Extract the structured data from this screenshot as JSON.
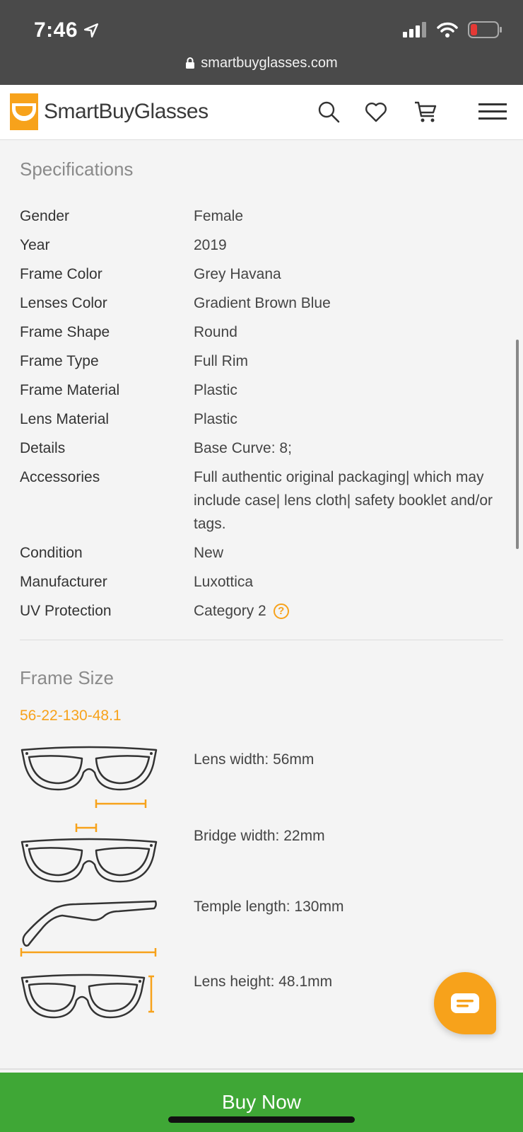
{
  "status_bar": {
    "time": "7:46",
    "url": "smartbuyglasses.com"
  },
  "header": {
    "logo_text": "SmartBuyGlasses",
    "brand_color": "#f7a21b"
  },
  "specifications": {
    "title": "Specifications",
    "rows": [
      {
        "label": "Gender",
        "value": "Female"
      },
      {
        "label": "Year",
        "value": "2019"
      },
      {
        "label": "Frame Color",
        "value": "Grey Havana"
      },
      {
        "label": "Lenses Color",
        "value": "Gradient Brown Blue"
      },
      {
        "label": "Frame Shape",
        "value": "Round"
      },
      {
        "label": "Frame Type",
        "value": "Full Rim"
      },
      {
        "label": "Frame Material",
        "value": "Plastic"
      },
      {
        "label": "Lens Material",
        "value": "Plastic"
      },
      {
        "label": "Details",
        "value": "Base Curve: 8;"
      },
      {
        "label": "Accessories",
        "value": "Full authentic original packaging| which may include case| lens cloth| safety booklet and/or tags."
      },
      {
        "label": "Condition",
        "value": "New"
      },
      {
        "label": "Manufacturer",
        "value": "Luxottica"
      },
      {
        "label": "UV Protection",
        "value": "Category 2"
      }
    ]
  },
  "frame_size": {
    "title": "Frame Size",
    "code": "56-22-130-48.1",
    "items": [
      {
        "label": "Lens width: 56mm",
        "icon": "lens-width-icon"
      },
      {
        "label": "Bridge width: 22mm",
        "icon": "bridge-width-icon"
      },
      {
        "label": "Temple length: 130mm",
        "icon": "temple-length-icon"
      },
      {
        "label": "Lens height: 48.1mm",
        "icon": "lens-height-icon"
      }
    ]
  },
  "buy_button": {
    "label": "Buy Now",
    "color": "#3fa736"
  }
}
